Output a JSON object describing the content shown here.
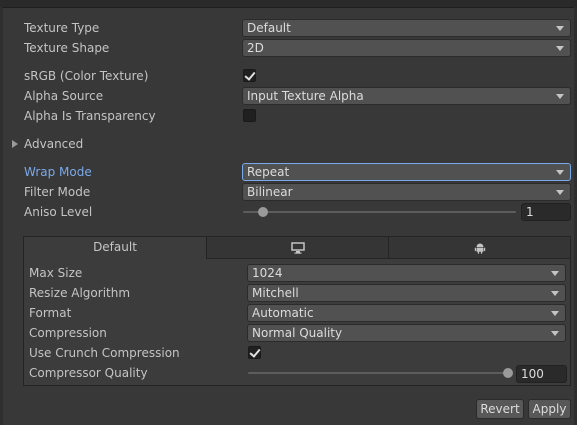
{
  "settings": {
    "texture_type": {
      "label": "Texture Type",
      "value": "Default"
    },
    "texture_shape": {
      "label": "Texture Shape",
      "value": "2D"
    },
    "srgb": {
      "label": "sRGB (Color Texture)",
      "checked": true
    },
    "alpha_source": {
      "label": "Alpha Source",
      "value": "Input Texture Alpha"
    },
    "alpha_is_transparency": {
      "label": "Alpha Is Transparency",
      "checked": false
    },
    "advanced": {
      "label": "Advanced"
    },
    "wrap_mode": {
      "label": "Wrap Mode",
      "value": "Repeat"
    },
    "filter_mode": {
      "label": "Filter Mode",
      "value": "Bilinear"
    },
    "aniso_level": {
      "label": "Aniso Level",
      "value": "1"
    }
  },
  "platform": {
    "tabs": [
      {
        "label": "Default",
        "icon": null
      },
      {
        "label": "",
        "icon": "monitor-icon"
      },
      {
        "label": "",
        "icon": "android-icon"
      }
    ],
    "max_size": {
      "label": "Max Size",
      "value": "1024"
    },
    "resize_algorithm": {
      "label": "Resize Algorithm",
      "value": "Mitchell"
    },
    "format": {
      "label": "Format",
      "value": "Automatic"
    },
    "compression": {
      "label": "Compression",
      "value": "Normal Quality"
    },
    "use_crunch": {
      "label": "Use Crunch Compression",
      "checked": true
    },
    "compressor_quality": {
      "label": "Compressor Quality",
      "value": "100"
    }
  },
  "actions": {
    "revert": "Revert",
    "apply": "Apply"
  },
  "colors": {
    "background": "#383838",
    "focus_accent": "#7aa9e9",
    "dropdown": "#515151"
  }
}
